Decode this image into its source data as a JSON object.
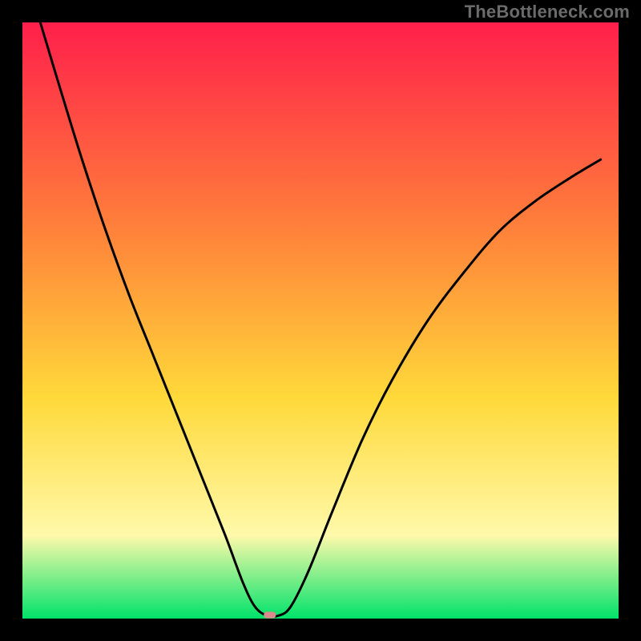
{
  "watermark": "TheBottleneck.com",
  "chart_data": {
    "type": "line",
    "title": "",
    "xlabel": "",
    "ylabel": "",
    "xlim": [
      0,
      100
    ],
    "ylim": [
      0,
      100
    ],
    "grid": false,
    "legend": false,
    "background_gradient": {
      "top_color": "#ff1f4b",
      "upper_mid_color": "#ff823a",
      "mid_color": "#ffd93a",
      "lower_mid_color": "#fff9aa",
      "bottom_color": "#00e36a"
    },
    "border_color": "#000000",
    "curve": {
      "color": "#000000",
      "stroke_width": 2,
      "min_x": 41,
      "points": [
        {
          "x": 3,
          "y": 100
        },
        {
          "x": 6,
          "y": 90
        },
        {
          "x": 10,
          "y": 77
        },
        {
          "x": 14,
          "y": 65
        },
        {
          "x": 18,
          "y": 54
        },
        {
          "x": 22,
          "y": 44
        },
        {
          "x": 26,
          "y": 34
        },
        {
          "x": 30,
          "y": 24
        },
        {
          "x": 34,
          "y": 14
        },
        {
          "x": 37,
          "y": 6
        },
        {
          "x": 39,
          "y": 2
        },
        {
          "x": 41,
          "y": 0.5
        },
        {
          "x": 43,
          "y": 0.5
        },
        {
          "x": 45,
          "y": 2
        },
        {
          "x": 48,
          "y": 8
        },
        {
          "x": 52,
          "y": 18
        },
        {
          "x": 57,
          "y": 30
        },
        {
          "x": 62,
          "y": 40
        },
        {
          "x": 68,
          "y": 50
        },
        {
          "x": 74,
          "y": 58
        },
        {
          "x": 80,
          "y": 65
        },
        {
          "x": 86,
          "y": 70
        },
        {
          "x": 92,
          "y": 74
        },
        {
          "x": 97,
          "y": 77
        }
      ]
    },
    "marker": {
      "x": 41.5,
      "y": 0.6,
      "width": 2.0,
      "height": 1.1,
      "fill": "#d98a8a",
      "rx": 0.6
    }
  }
}
